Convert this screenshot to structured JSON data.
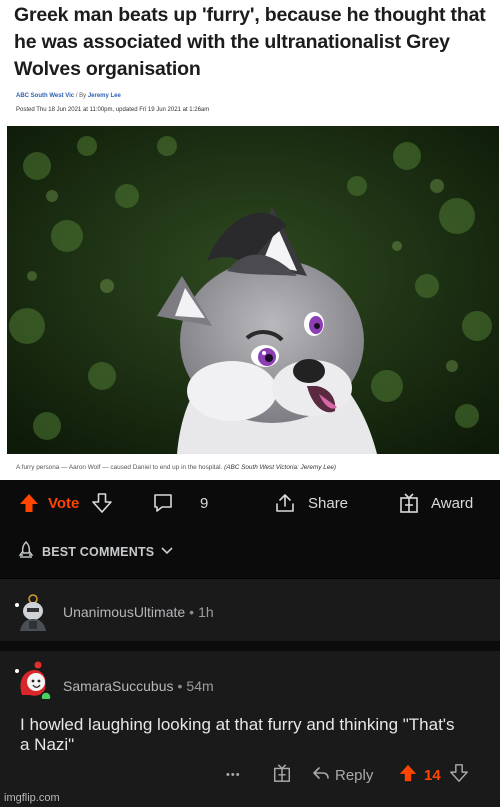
{
  "article": {
    "headline": "Greek man beats up 'furry', because he thought that he was associated with the ultranationalist Grey Wolves organisation",
    "source": "ABC South West Vic",
    "by": "/ By",
    "author": "Jeremy Lee",
    "posted": "Posted Thu 18 Jun 2021 at 11:00pm, updated Fri 19 Jun 2021 at 1:26am",
    "caption": "A furry persona — Aaron Wolf — caused Daniel to end up in the hospital.",
    "caption_credit": "(ABC South West Victoria: Jeremy Lee)"
  },
  "action_bar": {
    "vote_label": "Vote",
    "comment_count": "9",
    "share_label": "Share",
    "award_label": "Award"
  },
  "sort": {
    "label": "BEST COMMENTS"
  },
  "comments": [
    {
      "username": "UnanimousUltimate",
      "separator": "•",
      "age": "1h"
    },
    {
      "username": "SamaraSuccubus",
      "separator": "•",
      "age": "54m",
      "text": "I howled laughing looking at that furry and thinking \"That's a Nazi\"",
      "more": "•••",
      "reply_label": "Reply",
      "score": "14"
    }
  ],
  "watermark": "imgflip.com",
  "colors": {
    "upvote": "#ff4500",
    "background": "#0b0b0b",
    "card": "#1a1a1b"
  }
}
